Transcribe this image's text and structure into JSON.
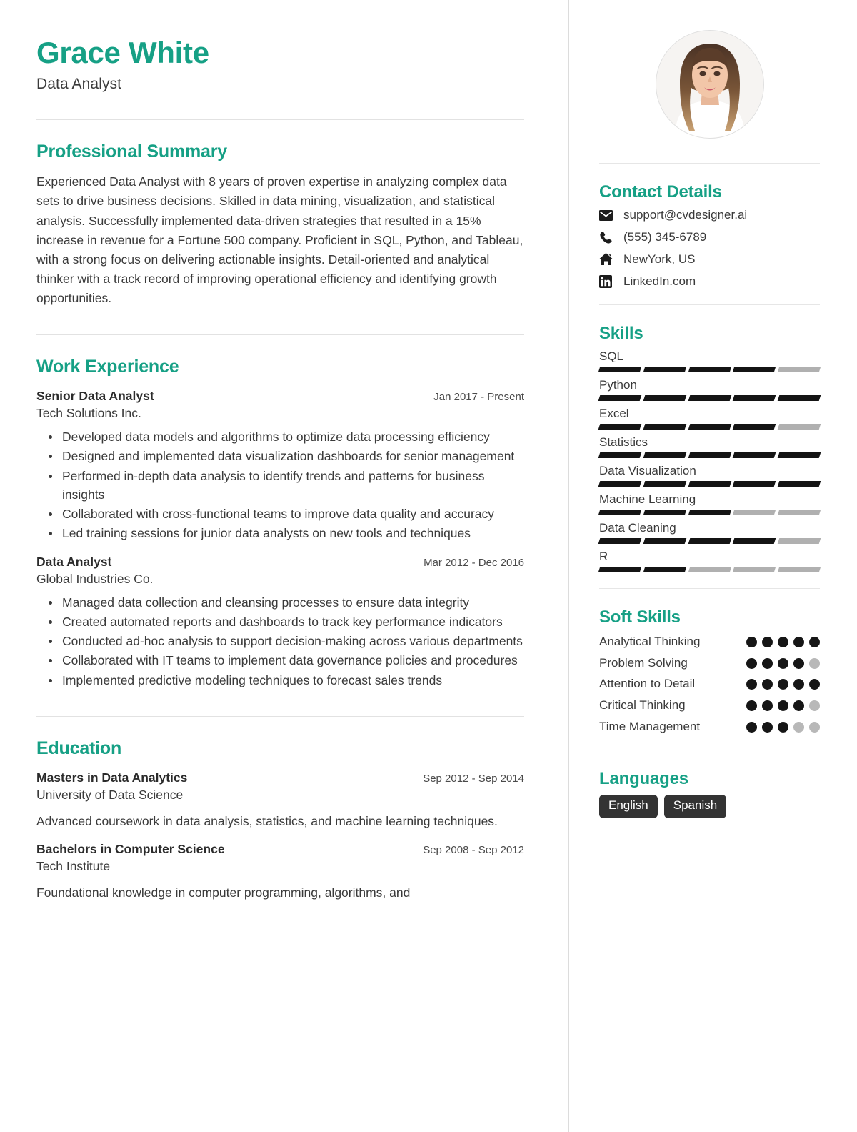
{
  "theme": {
    "accent": "#16a085",
    "text": "#3a3a3a",
    "bar_on": "#141414",
    "bar_off": "#b0b0b0",
    "pill_bg": "#333333"
  },
  "header": {
    "name": "Grace White",
    "job_title": "Data Analyst",
    "photo_alt": "profile-photo"
  },
  "left": {
    "summary_section": {
      "title": "Professional Summary",
      "text": "Experienced Data Analyst with 8 years of proven expertise in analyzing complex data sets to drive business decisions. Skilled in data mining, visualization, and statistical analysis. Successfully implemented data-driven strategies that resulted in a 15% increase in revenue for a Fortune 500 company. Proficient in SQL, Python, and Tableau, with a strong focus on delivering actionable insights. Detail-oriented and analytical thinker with a track record of improving operational efficiency and identifying growth opportunities."
    },
    "work_section": {
      "title": "Work Experience",
      "entries": [
        {
          "role": "Senior Data Analyst",
          "date": "Jan 2017 - Present",
          "org": "Tech Solutions Inc.",
          "bullets": [
            "Developed data models and algorithms to optimize data processing efficiency",
            "Designed and implemented data visualization dashboards for senior management",
            "Performed in-depth data analysis to identify trends and patterns for business insights",
            "Collaborated with cross-functional teams to improve data quality and accuracy",
            "Led training sessions for junior data analysts on new tools and techniques"
          ]
        },
        {
          "role": "Data Analyst",
          "date": "Mar 2012 - Dec 2016",
          "org": "Global Industries Co.",
          "bullets": [
            "Managed data collection and cleansing processes to ensure data integrity",
            "Created automated reports and dashboards to track key performance indicators",
            "Conducted ad-hoc analysis to support decision-making across various departments",
            "Collaborated with IT teams to implement data governance policies and procedures",
            "Implemented predictive modeling techniques to forecast sales trends"
          ]
        }
      ]
    },
    "education_section": {
      "title": "Education",
      "entries": [
        {
          "degree": "Masters in Data Analytics",
          "date": "Sep 2012 - Sep 2014",
          "school": "University of Data Science",
          "description": "Advanced coursework in data analysis, statistics, and machine learning techniques."
        },
        {
          "degree": "Bachelors in Computer Science",
          "date": "Sep 2008 - Sep 2012",
          "school": "Tech Institute",
          "description": "Foundational knowledge in computer programming, algorithms, and"
        }
      ]
    }
  },
  "right": {
    "contact_section": {
      "title": "Contact Details",
      "items": [
        {
          "icon": "envelope-icon",
          "value": "support@cvdesigner.ai"
        },
        {
          "icon": "phone-icon",
          "value": "(555) 345-6789"
        },
        {
          "icon": "home-icon",
          "value": "NewYork, US"
        },
        {
          "icon": "linkedin-icon",
          "value": "LinkedIn.com"
        }
      ]
    },
    "skills_section": {
      "title": "Skills",
      "max": 5,
      "items": [
        {
          "label": "SQL",
          "level": 4
        },
        {
          "label": "Python",
          "level": 5
        },
        {
          "label": "Excel",
          "level": 4
        },
        {
          "label": "Statistics",
          "level": 5
        },
        {
          "label": "Data Visualization",
          "level": 5
        },
        {
          "label": "Machine Learning",
          "level": 3
        },
        {
          "label": "Data Cleaning",
          "level": 4
        },
        {
          "label": "R",
          "level": 2
        }
      ]
    },
    "soft_skills_section": {
      "title": "Soft Skills",
      "max": 5,
      "items": [
        {
          "label": "Analytical Thinking",
          "level": 5
        },
        {
          "label": "Problem Solving",
          "level": 4
        },
        {
          "label": "Attention to Detail",
          "level": 5
        },
        {
          "label": "Critical Thinking",
          "level": 4
        },
        {
          "label": "Time Management",
          "level": 3
        }
      ]
    },
    "languages_section": {
      "title": "Languages",
      "items": [
        "English",
        "Spanish"
      ]
    }
  }
}
